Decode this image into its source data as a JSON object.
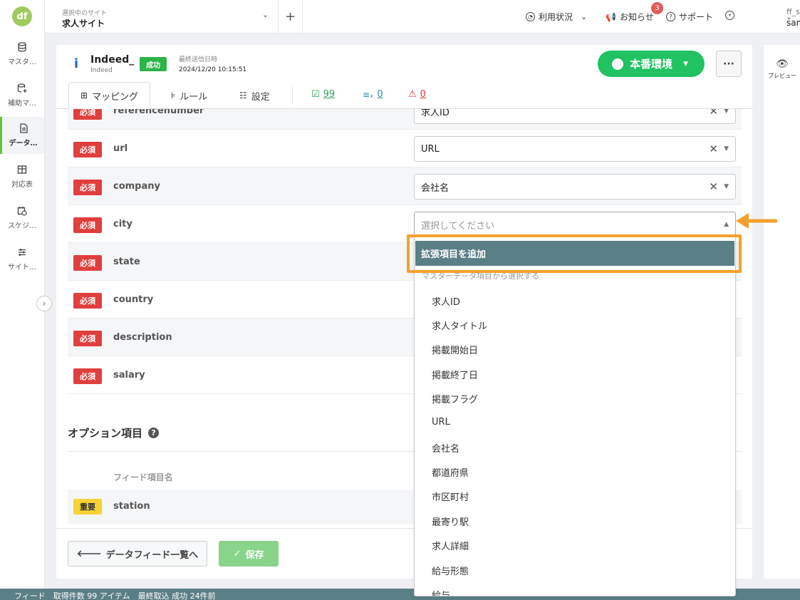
{
  "rail": {
    "logo": "df",
    "items": [
      {
        "label": "マスタ…"
      },
      {
        "label": "補助マ…"
      },
      {
        "label": "データ…"
      },
      {
        "label": "対応表"
      },
      {
        "label": "スケジ…"
      },
      {
        "label": "サイト…"
      }
    ],
    "toggle": "›"
  },
  "header": {
    "site_caption": "選択中のサイト",
    "site_name": "求人サイト",
    "plus": "+",
    "nav": {
      "usage": "利用状況",
      "news": "お知らせ",
      "news_badge": "3",
      "support": "サポート"
    },
    "user": {
      "name": "ff_sample",
      "account": "sample_g"
    }
  },
  "feed": {
    "logo": "i",
    "title": "Indeed_",
    "subtitle": "Indeed",
    "status": "成功",
    "last_sent_label": "最終送信日時",
    "last_sent_value": "2024/12/20 10:15:51",
    "env_button": "本番環境",
    "more": "···"
  },
  "tabs": [
    {
      "label": "マッピング"
    },
    {
      "label": "ルール"
    },
    {
      "label": "設定"
    }
  ],
  "stats": {
    "ok": "99",
    "excluded": "0",
    "errors": "0"
  },
  "required_rows": [
    {
      "badge": "必須",
      "field": "referencenumber",
      "value": "求人ID"
    },
    {
      "badge": "必須",
      "field": "url",
      "value": "URL"
    },
    {
      "badge": "必須",
      "field": "company",
      "value": "会社名"
    },
    {
      "badge": "必須",
      "field": "city",
      "placeholder": "選択してください"
    },
    {
      "badge": "必須",
      "field": "state"
    },
    {
      "badge": "必須",
      "field": "country"
    },
    {
      "badge": "必須",
      "field": "description"
    },
    {
      "badge": "必須",
      "field": "salary"
    }
  ],
  "options": {
    "title": "オプション項目",
    "column_header": "フィード項目名",
    "rows": [
      {
        "badge": "重要",
        "field": "station"
      }
    ]
  },
  "buttons": {
    "back": "データフィード一覧へ",
    "save": "保存"
  },
  "preview": {
    "label": "プレビュー"
  },
  "dropdown": {
    "add_extension": "拡張項目を追加",
    "group_label": "マスターデータ項目から選択する",
    "options": [
      "求人ID",
      "求人タイトル",
      "掲載開始日",
      "掲載終了日",
      "掲載フラグ",
      "URL",
      "会社名",
      "都道府県",
      "市区町村",
      "最寄り駅",
      "求人詳細",
      "給与形態",
      "給与"
    ]
  },
  "statusbar": {
    "text": "フィード　取得件数 99 アイテム　最終取込 成功 24件前"
  },
  "colors": {
    "accent_green": "#20c262",
    "required_red": "#e13e3e",
    "important_yellow": "#f6d436",
    "highlight_orange": "#f3a12c",
    "teal": "#5a7f86"
  }
}
